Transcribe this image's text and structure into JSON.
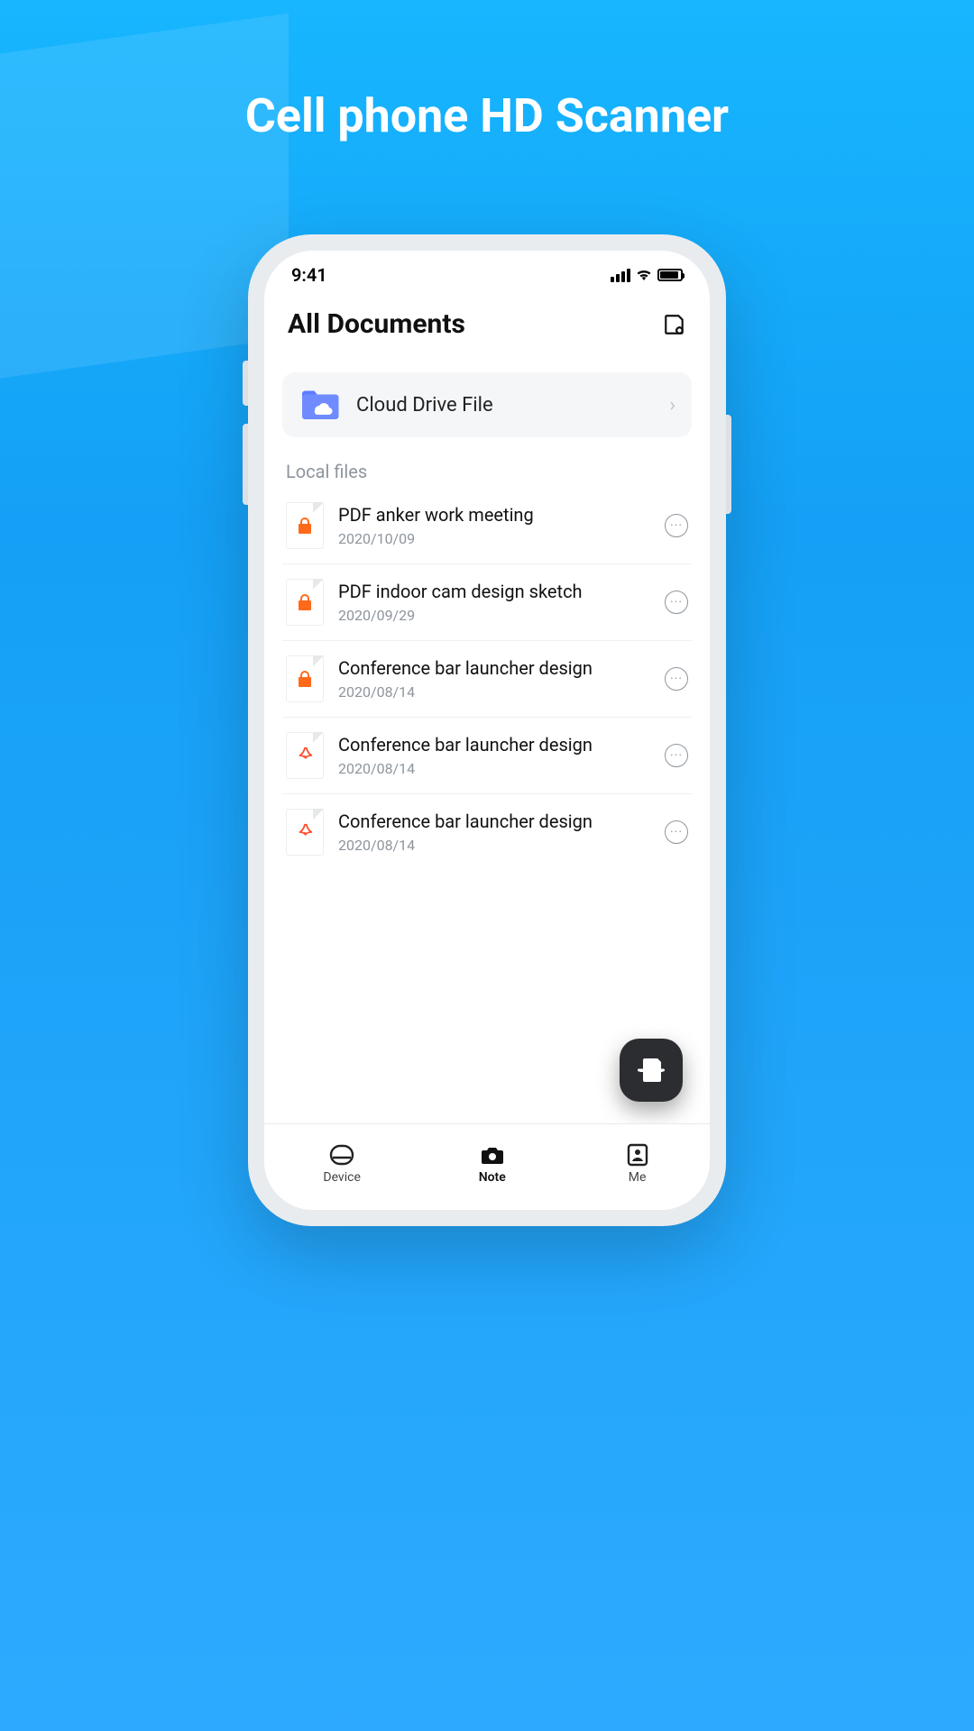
{
  "banner": {
    "title": "Cell phone HD Scanner"
  },
  "statusbar": {
    "time": "9:41"
  },
  "header": {
    "title": "All Documents"
  },
  "cloud": {
    "label": "Cloud Drive File"
  },
  "section": {
    "local_label": "Local files"
  },
  "files": [
    {
      "title": "PDF anker work meeting",
      "date": "2020/10/09",
      "icon": "lock"
    },
    {
      "title": "PDF indoor cam design sketch",
      "date": "2020/09/29",
      "icon": "lock"
    },
    {
      "title": "Conference bar launcher design",
      "date": "2020/08/14",
      "icon": "lock"
    },
    {
      "title": "Conference bar launcher design",
      "date": "2020/08/14",
      "icon": "pdf"
    },
    {
      "title": "Conference bar launcher design",
      "date": "2020/08/14",
      "icon": "pdf"
    }
  ],
  "tabs": {
    "device": "Device",
    "note": "Note",
    "me": "Me"
  }
}
